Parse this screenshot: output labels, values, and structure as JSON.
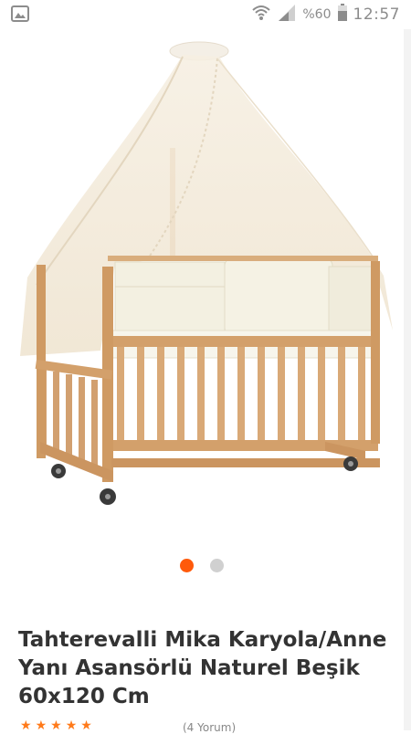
{
  "status_bar": {
    "battery_text": "%60",
    "time": "12:57",
    "icons": [
      "image-notification-icon",
      "wifi-icon",
      "signal-icon",
      "battery-icon"
    ]
  },
  "gallery": {
    "image_alt": "Tahterevalli Mika Karyola/Anne Yanı Asansörlü Naturel Beşik 60x120 Cm",
    "active_index": 0,
    "total": 2
  },
  "product": {
    "title": "Tahterevalli Mika Karyola/Anne Yanı Asansörlü Naturel Beşik 60x120 Cm",
    "rating": 5,
    "review_count": "(4 Yorum)"
  },
  "colors": {
    "accent": "#ff5a0b",
    "dot_inactive": "#d0d0d0",
    "title": "#333333",
    "star": "#ff7a1a"
  }
}
